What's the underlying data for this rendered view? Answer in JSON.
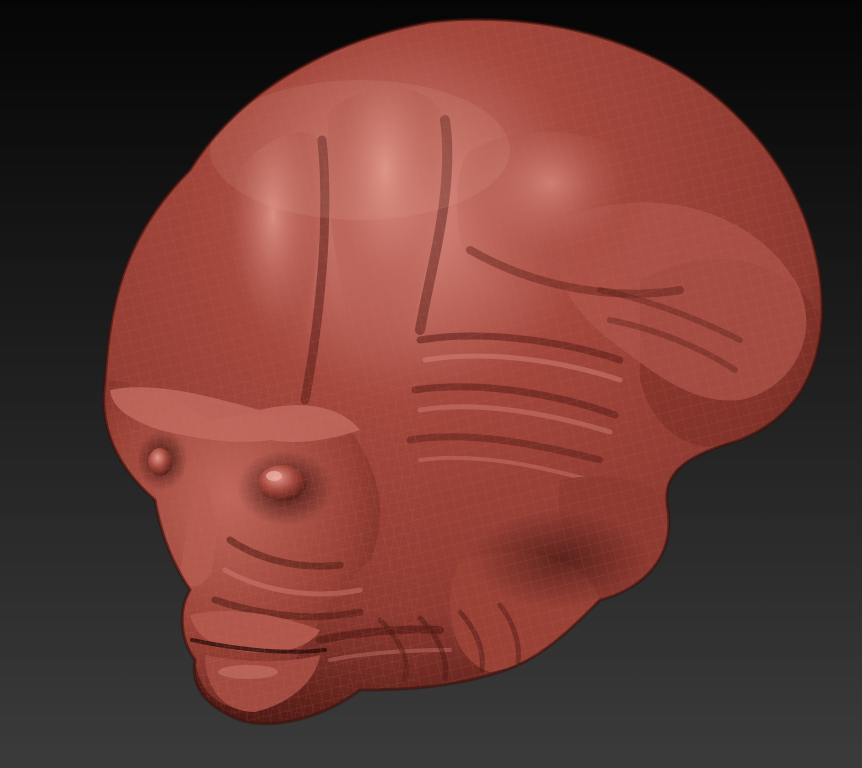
{
  "viewport": {
    "background": {
      "top_color": "#050505",
      "bottom_color": "#3b3b3b"
    },
    "model": {
      "subject": "sculpted-alien-head",
      "material": "red-wax",
      "wireframe": true,
      "colors": {
        "base": "#a4473c",
        "highlight": "#d98a80",
        "mid": "#8e3a31",
        "shadow": "#4e1913",
        "deep_shadow": "#2a0b08",
        "wire": "#c9776c"
      }
    }
  }
}
